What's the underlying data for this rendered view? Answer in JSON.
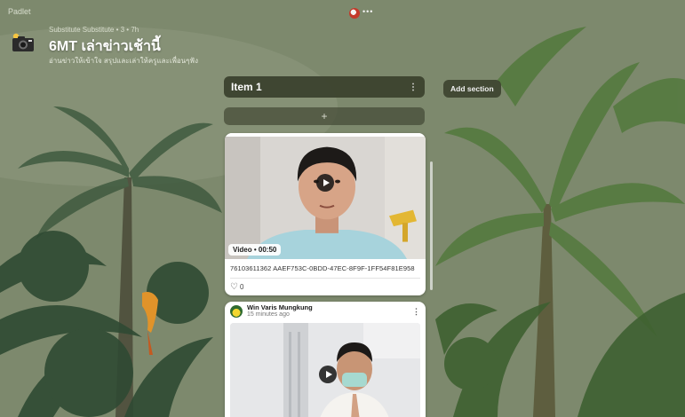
{
  "app": {
    "brand": "Padlet"
  },
  "topbar": {
    "dots": "•••"
  },
  "board": {
    "meta": "Substitute Substitute • 3 • 7h",
    "title": "6MT เล่าข่าวเช้านี้",
    "description": "อ่านข่าวให้เข้าใจ สรุปและเล่าให้ครูและเพื่อนๆฟัง"
  },
  "section": {
    "title": "Item 1",
    "menu": "⋮",
    "add_section_label": "Add section",
    "add_post_label": "+"
  },
  "posts": [
    {
      "badge": "Video • 00:50",
      "file_name": "76103611362 AAEF753C-0BDD-47EC-8F9F-1FF54F81E958",
      "likes": "0"
    },
    {
      "author": "Win Varis Mungkung",
      "time": "15 minutes ago",
      "menu": "⋮"
    }
  ],
  "colors": {
    "section_bg": "#3a402c",
    "card_bg": "#ffffff"
  },
  "icons": [
    "camera-icon",
    "play-icon",
    "heart-icon",
    "more-icon"
  ]
}
